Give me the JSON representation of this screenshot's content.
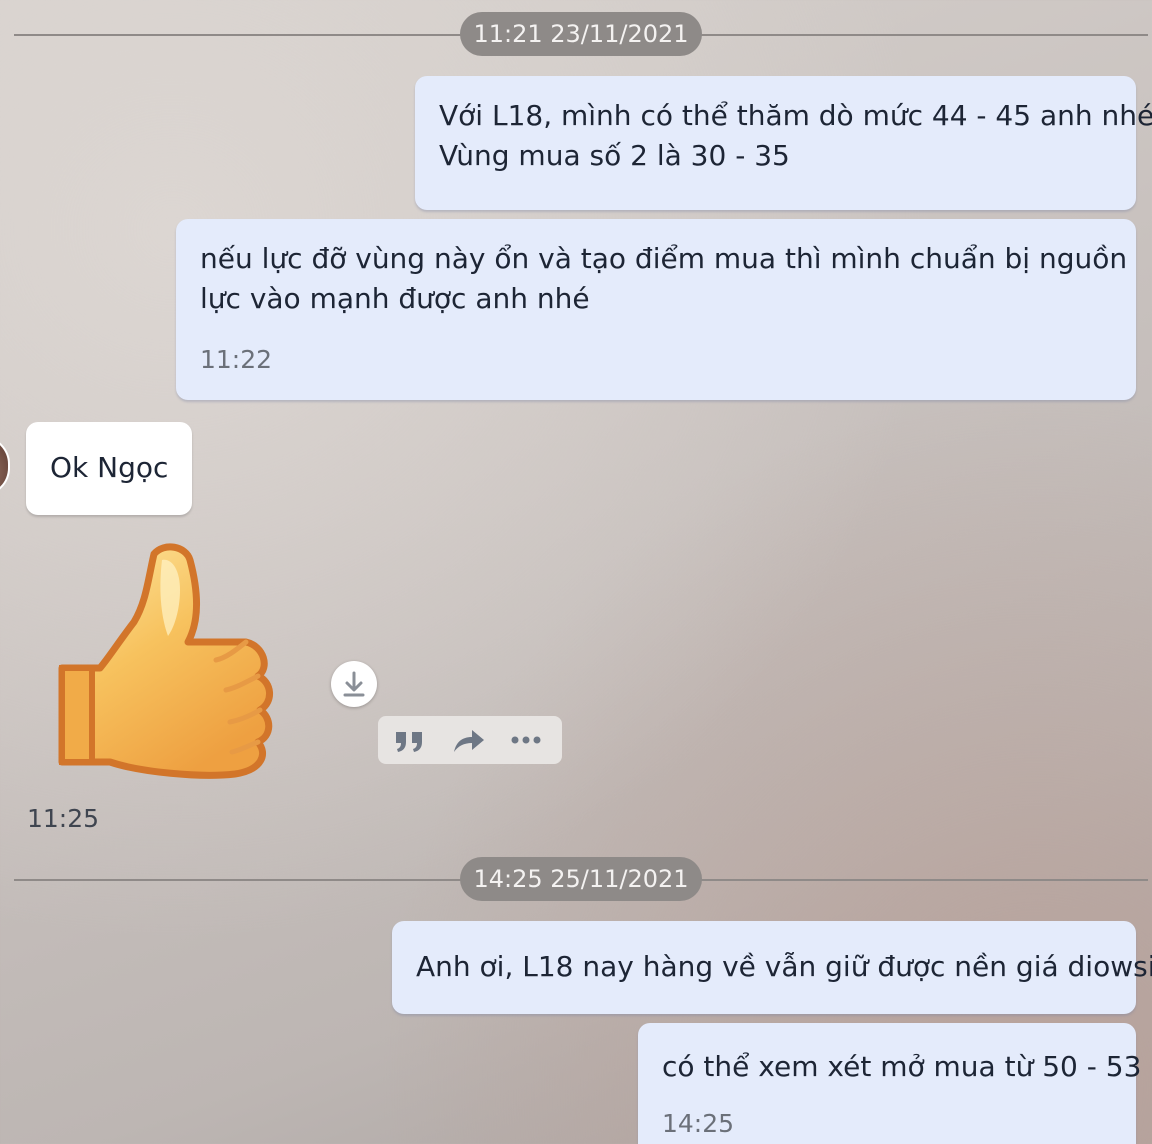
{
  "dividers": [
    {
      "label": "11:21 23/11/2021"
    },
    {
      "label": "14:25 25/11/2021"
    }
  ],
  "messages": [
    {
      "lines": [
        "Với L18, mình có thể thăm dò mức 44 - 45 anh nhé",
        "Vùng mua số 2 là 30 - 35"
      ]
    },
    {
      "lines": [
        "nếu lực đỡ vùng này ổn và tạo điểm mua thì mình chuẩn bị nguồn",
        "lực vào mạnh được anh nhé"
      ],
      "time": "11:22"
    },
    {
      "lines": [
        "Ok Ngọc"
      ]
    },
    {
      "sticker": "thumbs-up-icon",
      "time": "11:25"
    },
    {
      "lines": [
        "Anh ơi, L18 nay hàng về vẫn giữ được nền giá diowsi"
      ]
    },
    {
      "lines": [
        "có thể xem xét mở mua từ 50 - 53"
      ],
      "time": "14:25"
    }
  ],
  "actions": {
    "download_icon": "download-icon",
    "quote_icon": "quote-icon",
    "forward_icon": "forward-icon",
    "more_icon": "more-icon"
  },
  "colors": {
    "outgoing_bubble": "#e4ebfb",
    "incoming_bubble": "#ffffff",
    "divider_pill": "#8e8a88"
  }
}
